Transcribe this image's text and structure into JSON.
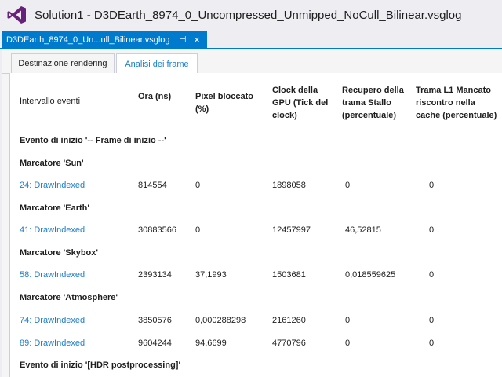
{
  "window": {
    "title": "Solution1 - D3DEarth_8974_0_Uncompressed_Unmipped_NoCull_Bilinear.vsglog"
  },
  "doc_tab": {
    "label": "D3DEarth_8974_0_Un...ull_Bilinear.vsglog",
    "pin": "⊣",
    "close": "×"
  },
  "subtabs": [
    {
      "label": "Destinazione rendering"
    },
    {
      "label": "Analisi dei frame"
    }
  ],
  "table": {
    "headers": [
      "Intervallo eventi",
      "Ora (ns)",
      "Pixel bloccato (%)",
      "Clock della GPU (Tick del clock)",
      "Recupero della trama Stallo (percentuale)",
      "Trama L1 Mancato riscontro nella cache (percentuale)"
    ],
    "groups": [
      {
        "label": "Evento di inizio '-- Frame di inizio --'"
      },
      {
        "label": "Marcatore 'Sun'"
      },
      {
        "label": "Marcatore 'Earth'"
      },
      {
        "label": "Marcatore 'Skybox'"
      },
      {
        "label": "Marcatore 'Atmosphere'"
      },
      {
        "label": "Evento di inizio '[HDR postprocessing]'"
      }
    ],
    "rows": [
      [
        "24: DrawIndexed",
        "814554",
        "0",
        "1898058",
        "0",
        "0"
      ],
      [
        "41: DrawIndexed",
        "30883566",
        "0",
        "12457997",
        "46,52815",
        "0"
      ],
      [
        "58: DrawIndexed",
        "2393134",
        "37,1993",
        "1503681",
        "0,018559625",
        "0"
      ],
      [
        "74: DrawIndexed",
        "3850576",
        "0,000288298",
        "2161260",
        "0",
        "0"
      ],
      [
        "89: DrawIndexed",
        "9604244",
        "94,6699",
        "4770796",
        "0",
        "0"
      ]
    ]
  },
  "colors": {
    "accent": "#007acc",
    "link": "#1e7ec8",
    "vs_purple": "#68217a"
  }
}
